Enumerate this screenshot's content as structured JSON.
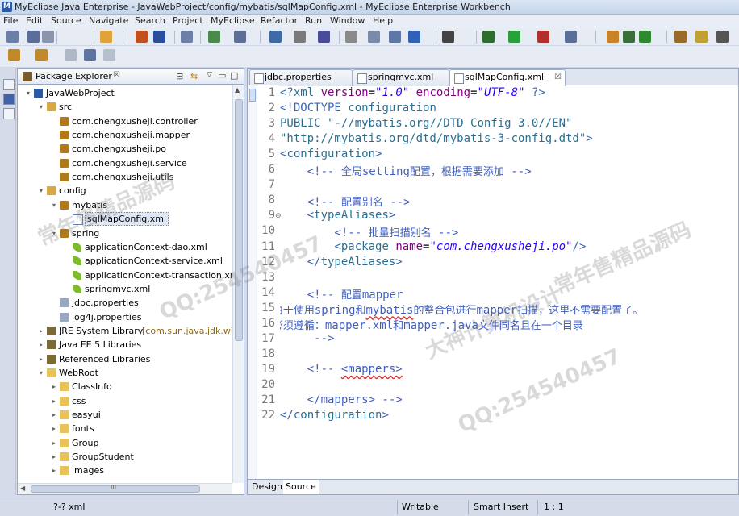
{
  "window": {
    "title": "MyEclipse Java Enterprise - JavaWebProject/config/mybatis/sqlMapConfig.xml - MyEclipse Enterprise Workbench"
  },
  "menu": [
    "File",
    "Edit",
    "Source",
    "Navigate",
    "Search",
    "Project",
    "MyEclipse",
    "Refactor",
    "Run",
    "Window",
    "Help"
  ],
  "package_explorer": {
    "title": "Package Explorer",
    "close": "☒",
    "tree": [
      {
        "label": "JavaWebProject",
        "depth": 0,
        "twisty": "▾",
        "icon": "project-icon"
      },
      {
        "label": "src",
        "depth": 1,
        "twisty": "▾",
        "icon": "source-folder-icon"
      },
      {
        "label": "com.chengxusheji.controller",
        "depth": 2,
        "twisty": "",
        "icon": "package-icon"
      },
      {
        "label": "com.chengxusheji.mapper",
        "depth": 2,
        "twisty": "",
        "icon": "package-icon"
      },
      {
        "label": "com.chengxusheji.po",
        "depth": 2,
        "twisty": "",
        "icon": "package-icon"
      },
      {
        "label": "com.chengxusheji.service",
        "depth": 2,
        "twisty": "",
        "icon": "package-icon"
      },
      {
        "label": "com.chengxusheji.utils",
        "depth": 2,
        "twisty": "",
        "icon": "package-icon"
      },
      {
        "label": "config",
        "depth": 1,
        "twisty": "▾",
        "icon": "source-folder-icon"
      },
      {
        "label": "mybatis",
        "depth": 2,
        "twisty": "▾",
        "icon": "package-icon"
      },
      {
        "label": "sqlMapConfig.xml",
        "depth": 3,
        "twisty": "",
        "icon": "xml-file-icon",
        "selected": true
      },
      {
        "label": "spring",
        "depth": 2,
        "twisty": "▾",
        "icon": "package-icon"
      },
      {
        "label": "applicationContext-dao.xml",
        "depth": 3,
        "twisty": "",
        "icon": "spring-leaf-icon"
      },
      {
        "label": "applicationContext-service.xml",
        "depth": 3,
        "twisty": "",
        "icon": "spring-leaf-icon"
      },
      {
        "label": "applicationContext-transaction.xm",
        "depth": 3,
        "twisty": "",
        "icon": "spring-leaf-icon"
      },
      {
        "label": "springmvc.xml",
        "depth": 3,
        "twisty": "",
        "icon": "spring-leaf-icon"
      },
      {
        "label": "jdbc.properties",
        "depth": 2,
        "twisty": "",
        "icon": "properties-file-icon"
      },
      {
        "label": "log4j.properties",
        "depth": 2,
        "twisty": "",
        "icon": "properties-file-icon"
      },
      {
        "label": "JRE System Library",
        "suffix": "[com.sun.java.jdk.win",
        "depth": 1,
        "twisty": "▸",
        "icon": "library-icon"
      },
      {
        "label": "Java EE 5 Libraries",
        "depth": 1,
        "twisty": "▸",
        "icon": "library-icon"
      },
      {
        "label": "Referenced Libraries",
        "depth": 1,
        "twisty": "▸",
        "icon": "library-icon"
      },
      {
        "label": "WebRoot",
        "depth": 1,
        "twisty": "▾",
        "icon": "folder-icon"
      },
      {
        "label": "ClassInfo",
        "depth": 2,
        "twisty": "▸",
        "icon": "folder-icon"
      },
      {
        "label": "css",
        "depth": 2,
        "twisty": "▸",
        "icon": "folder-icon"
      },
      {
        "label": "easyui",
        "depth": 2,
        "twisty": "▸",
        "icon": "folder-icon"
      },
      {
        "label": "fonts",
        "depth": 2,
        "twisty": "▸",
        "icon": "folder-icon"
      },
      {
        "label": "Group",
        "depth": 2,
        "twisty": "▸",
        "icon": "folder-icon"
      },
      {
        "label": "GroupStudent",
        "depth": 2,
        "twisty": "▸",
        "icon": "folder-icon"
      },
      {
        "label": "images",
        "depth": 2,
        "twisty": "▸",
        "icon": "folder-icon"
      }
    ],
    "hscroll_grip": "III"
  },
  "editor": {
    "tabs": [
      {
        "label": "jdbc.properties",
        "active": false
      },
      {
        "label": "springmvc.xml",
        "active": false
      },
      {
        "label": "sqlMapConfig.xml",
        "active": true
      }
    ],
    "close": "☒",
    "line_numbers": [
      "1",
      "2",
      "3",
      "4",
      "5",
      "6",
      "7",
      "8",
      "9",
      "10",
      "11",
      "12",
      "13",
      "14",
      "15",
      "16",
      "17",
      "18",
      "19",
      "20",
      "21",
      "22"
    ],
    "fold_marker_line": "9",
    "lines": [
      "<?xml version=\"1.0\" encoding=\"UTF-8\" ?>",
      "<!DOCTYPE configuration",
      "PUBLIC \"-//mybatis.org//DTD Config 3.0//EN\"",
      "\"http://mybatis.org/dtd/mybatis-3-config.dtd\">",
      "<configuration>",
      "    <!-- 全局setting配置，根据需要添加 -->",
      "",
      "    <!-- 配置别名 -->",
      "    <typeAliases>",
      "        <!-- 批量扫描别名 -->",
      "        <package name=\"com.chengxusheji.po\"/>",
      "    </typeAliases>",
      "",
      "    <!-- 配置mapper",
      "  由于使用spring和mybatis的整合包进行mapper扫描，这里不需要配置了。",
      "  必须遵循：mapper.xml和mapper.java文件同名且在一个目录",
      "     -->",
      "",
      "    <!-- <mappers>",
      "",
      "    </mappers> -->",
      "</configuration>"
    ],
    "bottom_tabs": [
      {
        "label": "Design",
        "active": false
      },
      {
        "label": "Source",
        "active": true
      }
    ]
  },
  "status": {
    "left": "?-? xml",
    "mode": "Writable",
    "insert": "Smart Insert",
    "position": "1 : 1"
  },
  "watermarks": [
    "QQ:254540457",
    "常年售精品源码",
    "大神计算机设计"
  ]
}
